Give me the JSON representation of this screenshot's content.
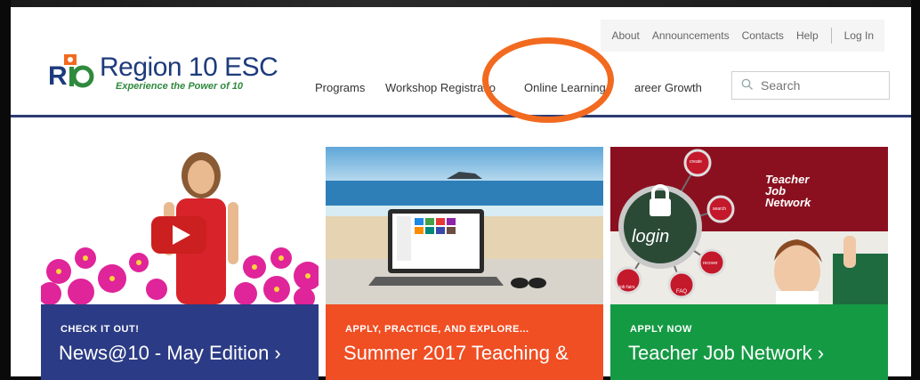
{
  "utility_nav": [
    "About",
    "Announcements",
    "Contacts",
    "Help",
    "Log In"
  ],
  "logo": {
    "title": "Region 10 ESC",
    "tagline": "Experience the Power of 10"
  },
  "main_nav": [
    "Programs",
    "Workshop Registratio",
    "Online Learning",
    "areer Growth"
  ],
  "search": {
    "placeholder": "Search"
  },
  "colors": {
    "navy": "#2b3b73",
    "orange": "#f04e23",
    "green": "#159a44",
    "highlight": "#f26a1f"
  },
  "cards": [
    {
      "kicker": "CHECK IT OUT!",
      "headline": "News@10 - May Edition ›",
      "color": "#2b3b85"
    },
    {
      "kicker": "APPLY, PRACTICE, AND EXPLORE...",
      "headline": "Summer 2017 Teaching &",
      "color": "#f04e23"
    },
    {
      "kicker": "APPLY NOW",
      "headline": "Teacher Job Network ›",
      "color": "#159a44",
      "image_text": {
        "title_lines": [
          "Teacher",
          "Job",
          "Network"
        ],
        "login": "login",
        "bubbles": [
          "create",
          "search",
          "recover",
          "FAQ",
          "job fairs"
        ]
      }
    }
  ]
}
